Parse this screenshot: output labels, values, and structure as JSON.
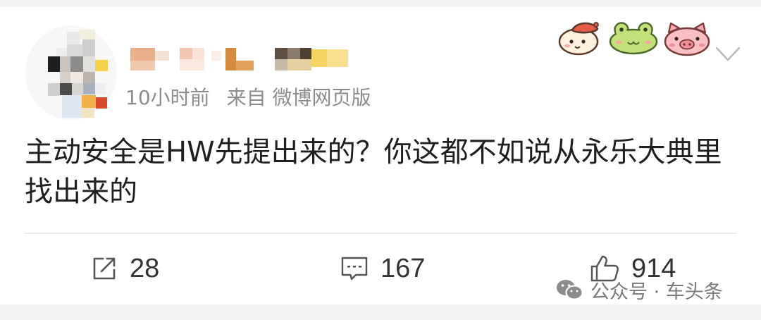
{
  "post": {
    "timestamp": "10小时前",
    "source": "来自 微博网页版",
    "content_lines": [
      "主动安全是HW先提出来的？你这都不如说从永乐大典里",
      "找出来的"
    ]
  },
  "header": {
    "badges": [
      "bear-badge-icon",
      "frog-badge-icon",
      "pig-badge-icon"
    ],
    "menu_icon": "chevron-down-icon"
  },
  "actions": {
    "share": {
      "icon": "share-icon",
      "count": "28"
    },
    "comment": {
      "icon": "comment-icon",
      "count": "167"
    },
    "like": {
      "icon": "thumbs-up-icon",
      "count": "914"
    }
  },
  "watermark": {
    "icon": "wechat-icon",
    "text": "公众号 · 车头条"
  },
  "colors": {
    "background": "#f2f2f2",
    "card": "#ffffff",
    "content_text": "#1f1f1f",
    "meta_text": "#8d8d8d",
    "count_text": "#333333",
    "icon_stroke": "#555555",
    "divider": "#ececec"
  }
}
